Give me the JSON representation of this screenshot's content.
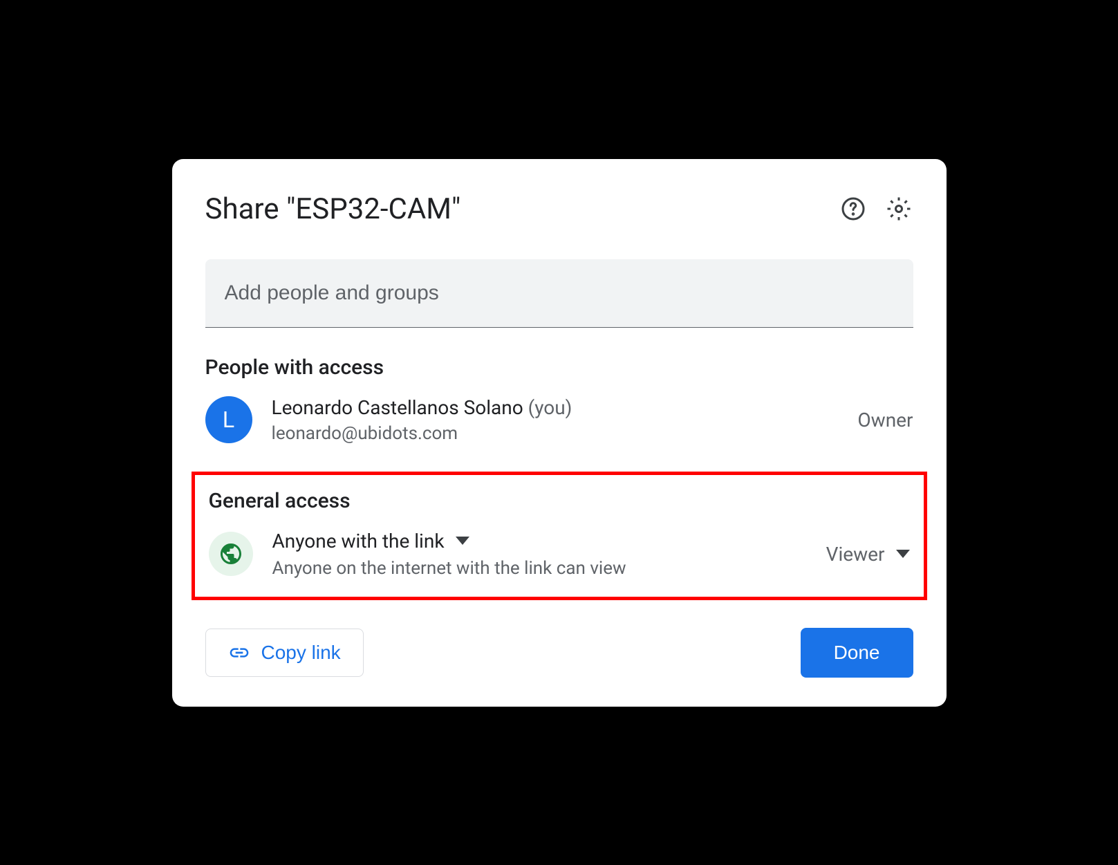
{
  "header": {
    "title": "Share \"ESP32-CAM\""
  },
  "input": {
    "placeholder": "Add people and groups"
  },
  "people_section": {
    "title": "People with access",
    "person": {
      "avatar_initial": "L",
      "name": "Leonardo Castellanos Solano",
      "you_label": "(you)",
      "email": "leonardo@ubidots.com",
      "role": "Owner"
    }
  },
  "general_section": {
    "title": "General access",
    "access_type": "Anyone with the link",
    "access_desc": "Anyone on the internet with the link can view",
    "role": "Viewer"
  },
  "footer": {
    "copy_link": "Copy link",
    "done": "Done"
  }
}
